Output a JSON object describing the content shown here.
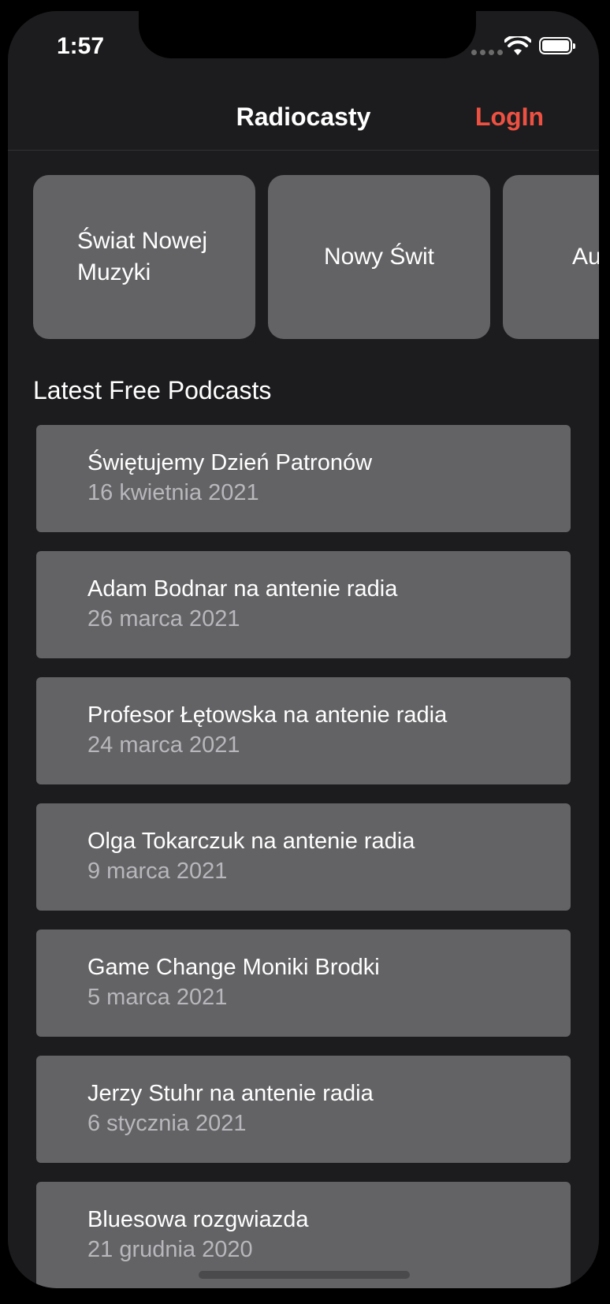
{
  "status_bar": {
    "time": "1:57"
  },
  "navbar": {
    "title": "Radiocasty",
    "login_label": "LogIn"
  },
  "carousel": [
    {
      "label": "Świat Nowej\nMuzyki"
    },
    {
      "label": "Nowy Świt"
    },
    {
      "label": "Au"
    }
  ],
  "section_title": "Latest Free Podcasts",
  "podcasts": [
    {
      "title": "Świętujemy Dzień Patronów",
      "date": "16 kwietnia 2021"
    },
    {
      "title": "Adam Bodnar na antenie radia",
      "date": "26 marca 2021"
    },
    {
      "title": "Profesor Łętowska na antenie radia",
      "date": "24 marca 2021"
    },
    {
      "title": "Olga Tokarczuk na antenie radia",
      "date": "9 marca 2021"
    },
    {
      "title": "Game Change Moniki Brodki",
      "date": "5 marca 2021"
    },
    {
      "title": "Jerzy Stuhr na antenie radia",
      "date": "6 stycznia 2021"
    },
    {
      "title": "Bluesowa rozgwiazda",
      "date": "21 grudnia 2020"
    }
  ],
  "colors": {
    "accent": "#ee5142",
    "background": "#1c1c1e",
    "card": "#636366"
  }
}
